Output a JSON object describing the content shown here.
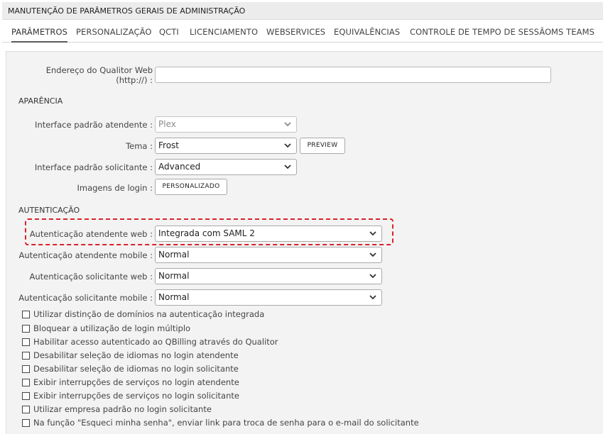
{
  "window": {
    "title": "MANUTENÇÃO DE PARÂMETROS GERAIS DE ADMINISTRAÇÃO"
  },
  "tabs": [
    {
      "label": "PARÂMETROS",
      "active": true
    },
    {
      "label": "PERSONALIZAÇÃO"
    },
    {
      "label": "QCTI"
    },
    {
      "label": "LICENCIAMENTO"
    },
    {
      "label": "WEBSERVICES"
    },
    {
      "label": "EQUIVALÊNCIAS"
    },
    {
      "label": "CONTROLE DE TEMPO DE SESSÃO"
    },
    {
      "label": "MS TEAMS"
    }
  ],
  "fields": {
    "address": {
      "label_line1": "Endereço do Qualitor Web",
      "label_line2": "(http://) :",
      "value": ""
    }
  },
  "appearance": {
    "section_title": "APARÊNCIA",
    "interface_attendant": {
      "label": "Interface padrão atendente :",
      "value": "Plex"
    },
    "theme": {
      "label": "Tema :",
      "value": "Frost"
    },
    "preview_button": "PREVIEW",
    "interface_requester": {
      "label": "Interface padrão solicitante :",
      "value": "Advanced"
    },
    "login_images": {
      "label": "Imagens de login :"
    },
    "custom_button": "PERSONALIZADO"
  },
  "authentication": {
    "section_title": "AUTENTICAÇÃO",
    "attendant_web": {
      "label": "Autenticação atendente web :",
      "value": "Integrada com SAML 2"
    },
    "attendant_mobile": {
      "label": "Autenticação atendente mobile :",
      "value": "Normal"
    },
    "requester_web": {
      "label": "Autenticação solicitante web :",
      "value": "Normal"
    },
    "requester_mobile": {
      "label": "Autenticação solicitante mobile :",
      "value": "Normal"
    }
  },
  "checkboxes": [
    {
      "label": "Utilizar distinção de domínios na autenticação integrada",
      "checked": false
    },
    {
      "label": "Bloquear a utilização de login múltiplo",
      "checked": false
    },
    {
      "label": "Habilitar acesso autenticado ao QBilling através do Qualitor",
      "checked": false
    },
    {
      "label": "Desabilitar seleção de idiomas no login atendente",
      "checked": false
    },
    {
      "label": "Desabilitar seleção de idiomas no login solicitante",
      "checked": false
    },
    {
      "label": "Exibir interrupções de serviços no login atendente",
      "checked": false
    },
    {
      "label": "Exibir interrupções de serviços no login solicitante",
      "checked": false
    },
    {
      "label": "Utilizar empresa padrão no login solicitante",
      "checked": false
    },
    {
      "label": "Na função \"Esqueci minha senha\", enviar link para troca de senha para o e-mail do solicitante",
      "checked": false
    }
  ],
  "colors": {
    "highlight_border": "#d9222a",
    "panel_bg": "#f3f3f3"
  },
  "icons": {
    "select_arrow": "chevron-down-icon"
  }
}
